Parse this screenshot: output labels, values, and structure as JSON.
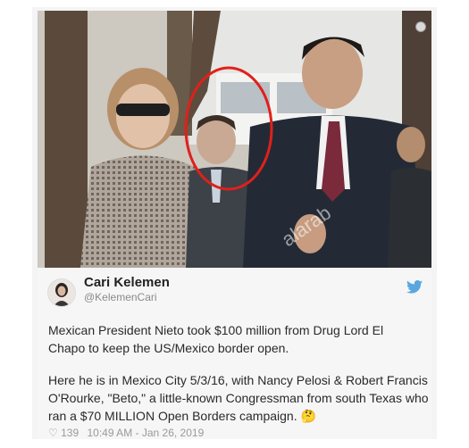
{
  "tweet": {
    "name": "Cari Kelemen",
    "handle": "@KelemenCari",
    "paragraph1": "Mexican President Nieto took $100 million from Drug Lord El Chapo to keep the US/Mexico border open.",
    "paragraph2": "Here he is in Mexico City 5/3/16, with Nancy Pelosi & Robert Francis O'Rourke, \"Beto,\" a little-known Congressman from south Texas who ran a  $70 MILLION Open Borders campaign. 🤔",
    "likes": "139",
    "timestamp": "10:49 AM - Jan 26, 2019"
  },
  "icons": {
    "bird": "twitter-bird-icon",
    "heart": "heart-icon"
  },
  "colors": {
    "circle": "#e0201b",
    "twitter_blue": "#5aa7e0"
  }
}
